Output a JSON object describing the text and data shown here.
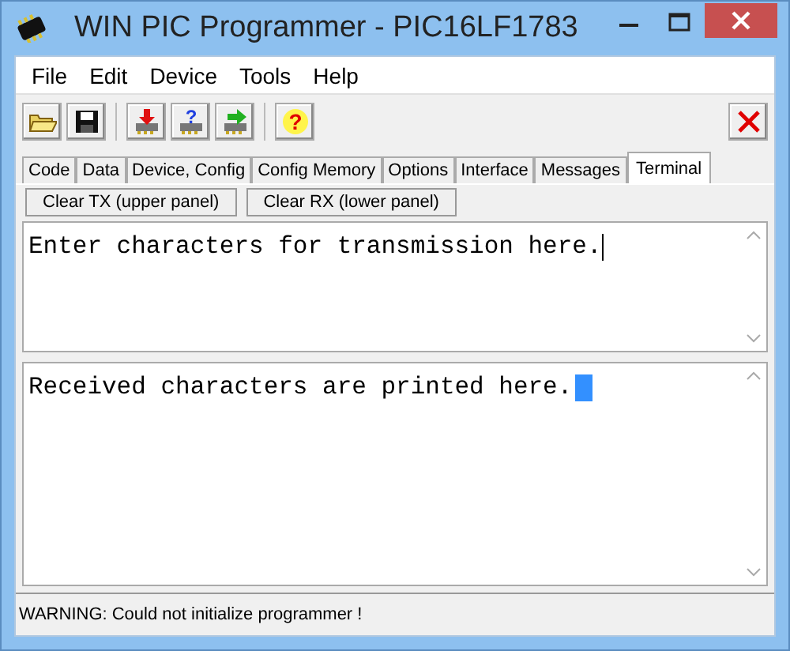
{
  "window": {
    "title": "WIN PIC Programmer - PIC16LF1783"
  },
  "menu": [
    "File",
    "Edit",
    "Device",
    "Tools",
    "Help"
  ],
  "toolbar": [
    {
      "kind": "open"
    },
    {
      "kind": "save"
    },
    {
      "kind": "program"
    },
    {
      "kind": "verify",
      "glyph": "?"
    },
    {
      "kind": "read"
    },
    {
      "kind": "help",
      "glyph": "?"
    }
  ],
  "tabs": [
    {
      "label": "Code",
      "selected": false
    },
    {
      "label": "Data",
      "selected": false
    },
    {
      "label": "Device, Config",
      "selected": false
    },
    {
      "label": "Config Memory",
      "selected": false
    },
    {
      "label": "Options",
      "selected": false
    },
    {
      "label": "Interface",
      "selected": false
    },
    {
      "label": "Messages",
      "selected": false
    },
    {
      "label": "Terminal",
      "selected": true
    }
  ],
  "buttons": [
    "Clear TX (upper panel)",
    "Clear RX (lower panel)"
  ],
  "tx_panel": {
    "text": "Enter characters for transmission here."
  },
  "rx_panel": {
    "text": "Received characters are printed here."
  },
  "status_bar": "WARNING: Could not initialize programmer !"
}
